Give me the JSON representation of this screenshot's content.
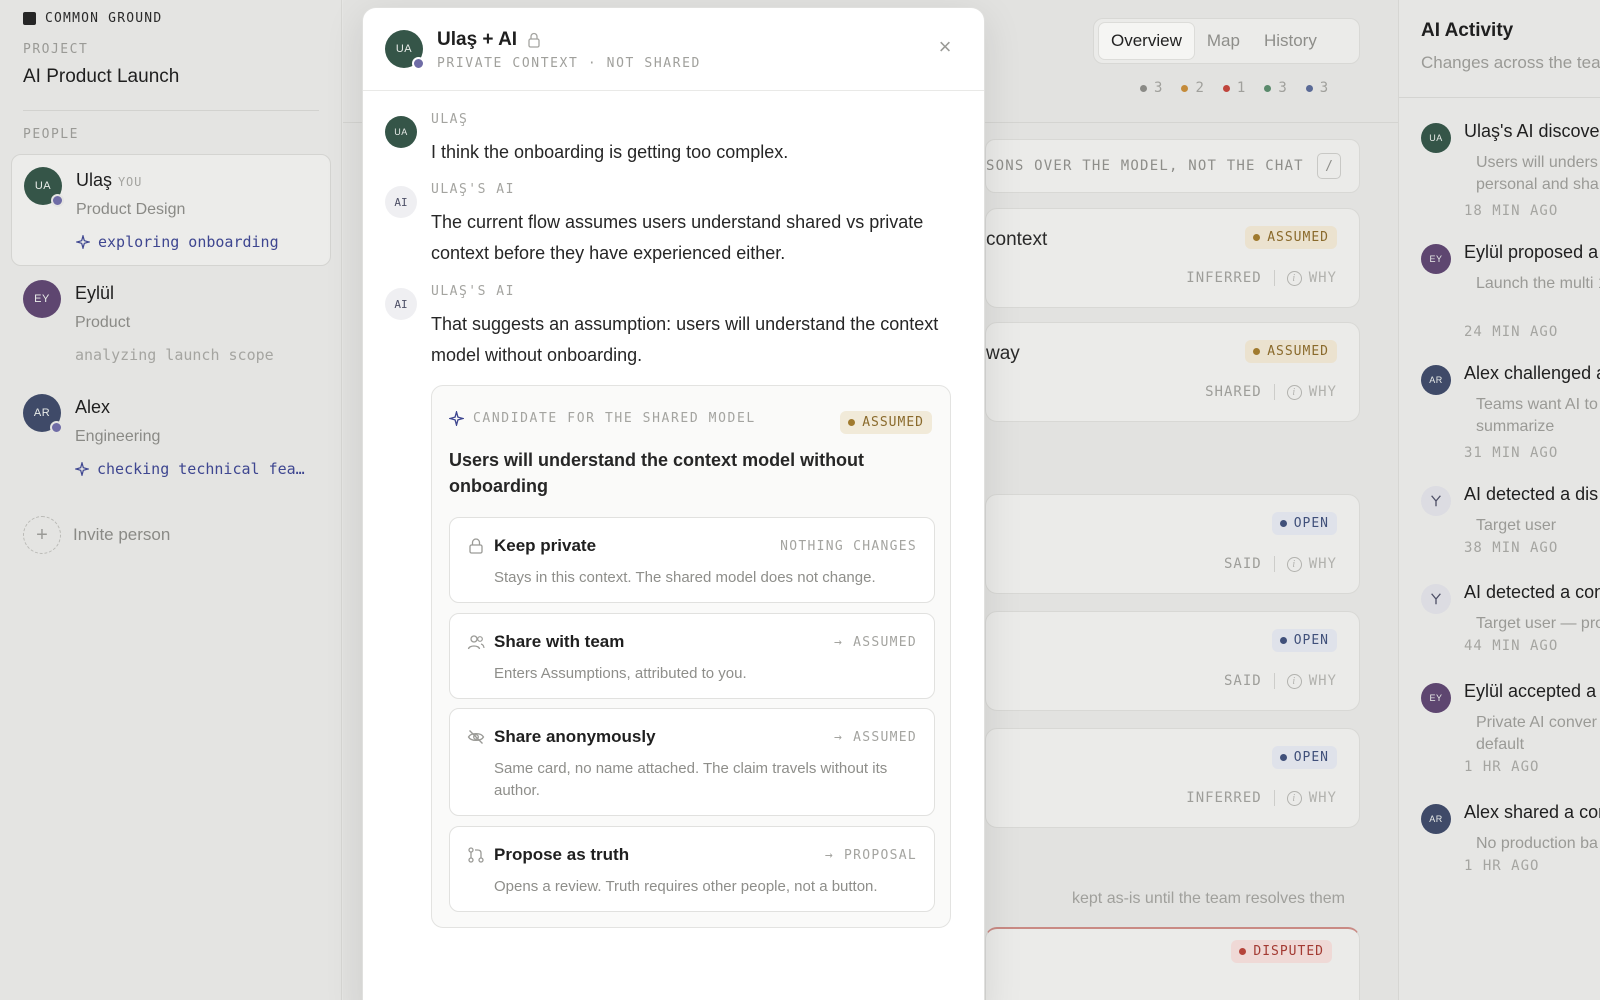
{
  "brand": "COMMON GROUND",
  "project": {
    "label": "PROJECT",
    "name": "AI Product Launch"
  },
  "people": {
    "label": "PEOPLE",
    "items": [
      {
        "initials": "UA",
        "name": "Ulaş",
        "tag": "YOU",
        "role": "Product Design",
        "status": "exploring onboarding",
        "color": "#355548"
      },
      {
        "initials": "EY",
        "name": "Eylül",
        "tag": "",
        "role": "Product",
        "status": "analyzing launch scope",
        "color": "#5e4670"
      },
      {
        "initials": "AR",
        "name": "Alex",
        "tag": "",
        "role": "Engineering",
        "status": "checking technical fea…",
        "color": "#3f4a68"
      }
    ],
    "invite": "Invite person"
  },
  "tabs": [
    "Overview",
    "Map",
    "History"
  ],
  "counts": [
    {
      "value": "3",
      "color": "#8a8a86"
    },
    {
      "value": "2",
      "color": "#c48b3a"
    },
    {
      "value": "1",
      "color": "#c0453c"
    },
    {
      "value": "3",
      "color": "#5a8a6c"
    },
    {
      "value": "3",
      "color": "#5a6a96"
    }
  ],
  "instruction": {
    "text": "SONS OVER THE MODEL, NOT THE CHAT",
    "key": "/"
  },
  "cards": [
    {
      "title": "context",
      "badge": "ASSUMED",
      "source": "INFERRED",
      "why": "WHY"
    },
    {
      "title": "way",
      "badge": "ASSUMED",
      "source": "SHARED",
      "why": "WHY"
    },
    {
      "title": "",
      "badge": "OPEN",
      "source": "SAID",
      "why": "WHY"
    },
    {
      "title": "",
      "badge": "OPEN",
      "source": "SAID",
      "why": "WHY"
    },
    {
      "title": "",
      "badge": "OPEN",
      "source": "INFERRED",
      "why": "WHY"
    }
  ],
  "footnote": "kept as-is until the team resolves them",
  "disputed_badge": "DISPUTED",
  "activity": {
    "title": "AI Activity",
    "subtitle": "Changes across the tea",
    "items": [
      {
        "initials": "UA",
        "color": "#355548",
        "head": "Ulaş's AI discove",
        "body": "Users will unders personal and sha",
        "time": "18 MIN AGO"
      },
      {
        "initials": "EY",
        "color": "#5e4670",
        "head": "Eylül proposed a",
        "body": "Launch the multi 1",
        "time": "24 MIN AGO"
      },
      {
        "initials": "AR",
        "color": "#3f4a68",
        "head": "Alex challenged a",
        "body": "Teams want AI to than summarize",
        "time": "31 MIN AGO"
      },
      {
        "initials": "",
        "color": "",
        "head": "AI detected a dis",
        "body": "Target user",
        "time": "38 MIN AGO"
      },
      {
        "initials": "",
        "color": "",
        "head": "AI detected a con",
        "body": "Target user — pro",
        "time": "44 MIN AGO"
      },
      {
        "initials": "EY",
        "color": "#5e4670",
        "head": "Eylül accepted a",
        "body": "Private AI conver default",
        "time": "1 HR AGO"
      },
      {
        "initials": "AR",
        "color": "#3f4a68",
        "head": "Alex shared a con",
        "body": "No production ba",
        "time": "1 HR AGO"
      }
    ]
  },
  "modal": {
    "avatar": "UA",
    "title": "Ulaş + AI",
    "subtitle": "PRIVATE CONTEXT · NOT SHARED",
    "close": "×",
    "messages": [
      {
        "author": "ULAŞ",
        "avatar": "UA",
        "text": "I think the onboarding is getting too complex."
      },
      {
        "author": "ULAŞ'S AI",
        "avatar": "AI",
        "text": "The current flow assumes users understand shared vs private context before they have experienced either."
      },
      {
        "author": "ULAŞ'S AI",
        "avatar": "AI",
        "text": "That suggests an assumption: users will understand the context model without onboarding."
      }
    ],
    "candidate": {
      "label": "CANDIDATE FOR THE SHARED MODEL",
      "badge": "ASSUMED",
      "claim": "Users will understand the context model without onboarding",
      "options": [
        {
          "icon": "lock-icon",
          "title": "Keep private",
          "right": "NOTHING CHANGES",
          "arrow": "",
          "desc": "Stays in this context. The shared model does not change."
        },
        {
          "icon": "team-icon",
          "title": "Share with team",
          "right": "ASSUMED",
          "arrow": "→",
          "desc": "Enters Assumptions, attributed to you."
        },
        {
          "icon": "eye-off-icon",
          "title": "Share anonymously",
          "right": "ASSUMED",
          "arrow": "→",
          "desc": "Same card, no name attached. The claim travels without its author."
        },
        {
          "icon": "git-pull-icon",
          "title": "Propose as truth",
          "right": "PROPOSAL",
          "arrow": "→",
          "desc": "Opens a review. Truth requires other people, not a button."
        }
      ]
    }
  }
}
